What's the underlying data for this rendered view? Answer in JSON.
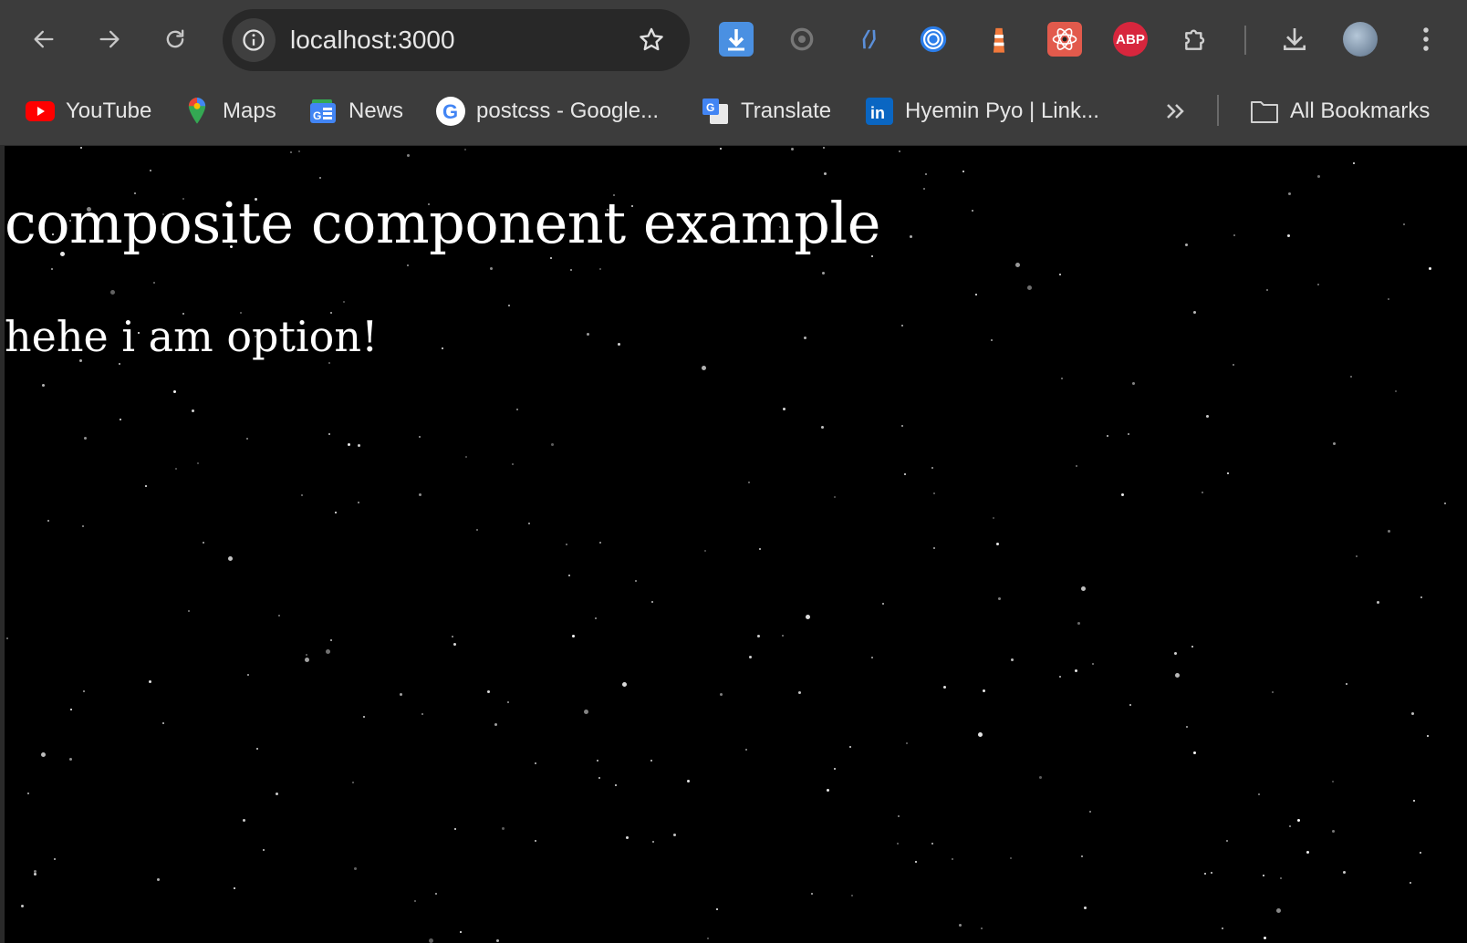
{
  "browser": {
    "url": "localhost:3000",
    "extensions": [
      {
        "name": "download-helper-icon"
      },
      {
        "name": "sync-icon"
      },
      {
        "name": "devtools-icon"
      },
      {
        "name": "target-icon"
      },
      {
        "name": "lighthouse-icon"
      },
      {
        "name": "react-devtools-icon"
      },
      {
        "name": "adblock-icon",
        "label": "ABP"
      },
      {
        "name": "extensions-puzzle-icon"
      }
    ]
  },
  "bookmarks": {
    "items": [
      {
        "label": "YouTube",
        "icon": "youtube-icon"
      },
      {
        "label": "Maps",
        "icon": "maps-icon"
      },
      {
        "label": "News",
        "icon": "news-icon"
      },
      {
        "label": "postcss - Google...",
        "icon": "google-icon"
      },
      {
        "label": "Translate",
        "icon": "translate-icon"
      },
      {
        "label": "Hyemin Pyo | Link...",
        "icon": "linkedin-icon"
      }
    ],
    "all_bookmarks": "All Bookmarks"
  },
  "page": {
    "title": "composite component example",
    "option_text": "hehe i am option!"
  },
  "colors": {
    "toolbar_bg": "#3c3c3c",
    "omnibox_bg": "#282828",
    "page_bg": "#000000",
    "text": "#ffffff"
  }
}
